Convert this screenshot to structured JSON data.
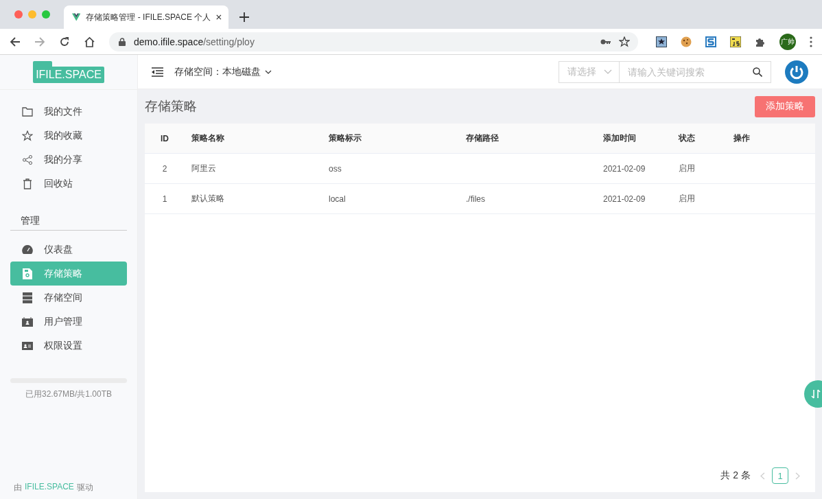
{
  "browser": {
    "tab_title": "存储策略管理 - IFILE.SPACE 个人",
    "url_host": "demo.ifile.space",
    "url_path": "/setting/ploy",
    "profile": "广帅"
  },
  "logo": "IFILE.SPACE",
  "header": {
    "storage_label": "存储空间：",
    "storage_value": "本地磁盘",
    "select_placeholder": "请选择",
    "search_placeholder": "请输入关键词搜索"
  },
  "sidebar": {
    "items": [
      {
        "label": "我的文件",
        "kind": "folder",
        "selected": false
      },
      {
        "label": "我的收藏",
        "kind": "star",
        "selected": false
      },
      {
        "label": "我的分享",
        "kind": "share",
        "selected": false
      },
      {
        "label": "回收站",
        "kind": "trash",
        "selected": false
      }
    ],
    "section": "管理",
    "admin_items": [
      {
        "label": "仪表盘",
        "kind": "gauge",
        "selected": false
      },
      {
        "label": "存储策略",
        "kind": "disk",
        "selected": true
      },
      {
        "label": "存储空间",
        "kind": "server",
        "selected": false
      },
      {
        "label": "用户管理",
        "kind": "user",
        "selected": false
      },
      {
        "label": "权限设置",
        "kind": "card",
        "selected": false
      }
    ],
    "usage": {
      "text": "已用32.67MB/共1.00TB"
    },
    "footer_prefix": "由",
    "footer_link": "IFILE.SPACE",
    "footer_suffix": "驱动"
  },
  "page": {
    "title": "存储策略",
    "add_button": "添加策略"
  },
  "table": {
    "columns": [
      "ID",
      "策略名称",
      "策略标示",
      "存储路径",
      "添加时间",
      "状态",
      "操作"
    ],
    "rows": [
      [
        "2",
        "阿里云",
        "oss",
        "",
        "2021-02-09",
        "启用",
        ""
      ],
      [
        "1",
        "默认策略",
        "local",
        "./files",
        "2021-02-09",
        "启用",
        ""
      ]
    ]
  },
  "pagination": {
    "total": "共 2 条",
    "pages": [
      {
        "label": "1",
        "selected": true
      }
    ]
  }
}
